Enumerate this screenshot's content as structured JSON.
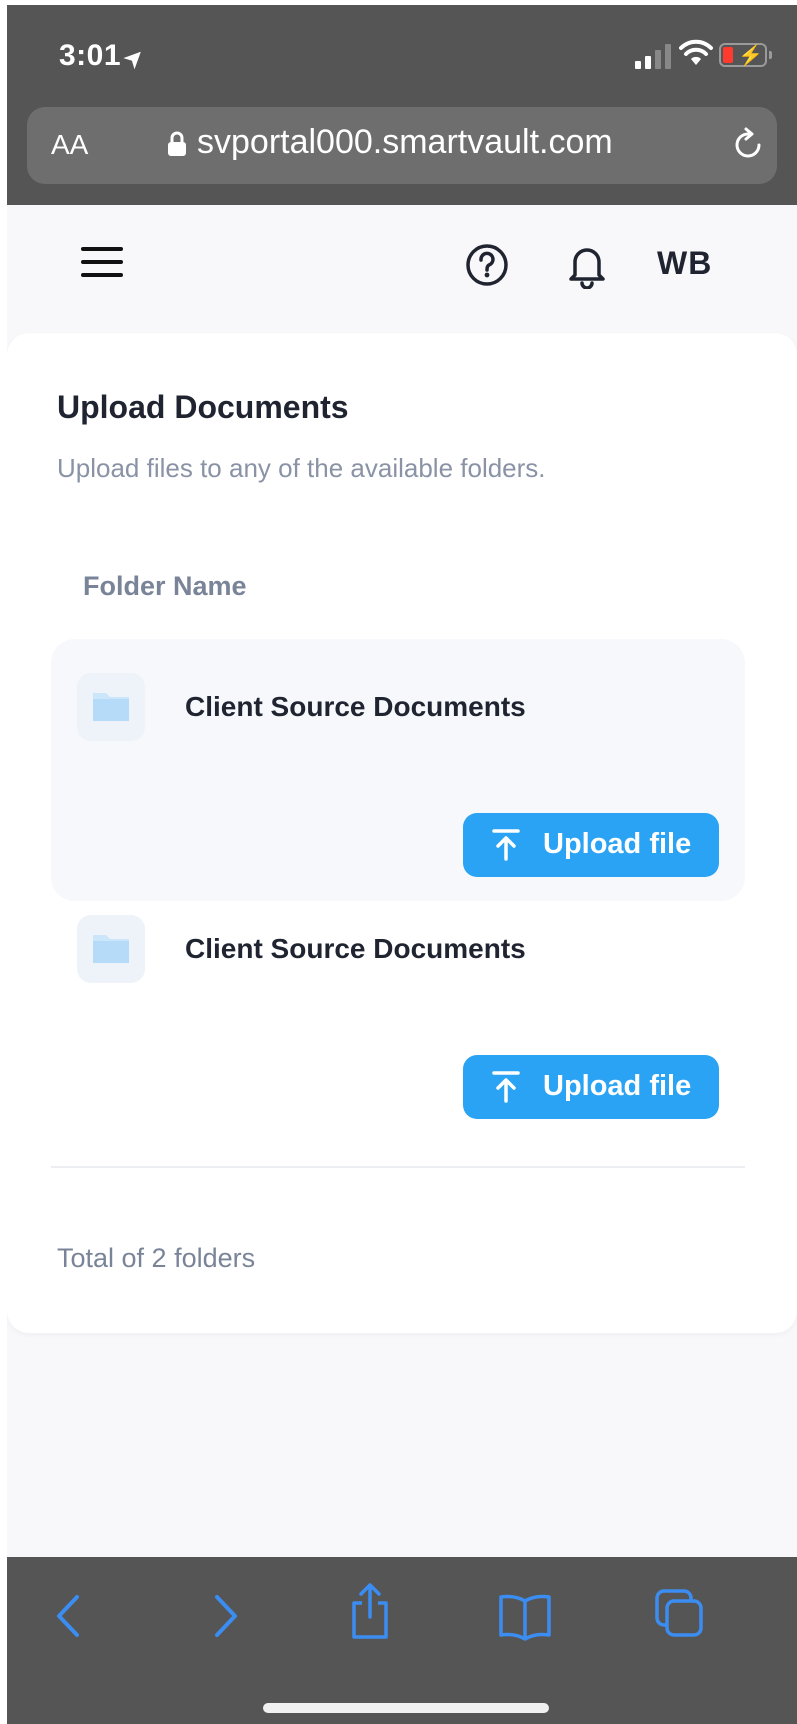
{
  "status_bar": {
    "time": "3:01"
  },
  "browser": {
    "text_size_label": "AA",
    "url": "svportal000.smartvault.com"
  },
  "header": {
    "user_initials": "WB"
  },
  "page": {
    "title": "Upload Documents",
    "subtitle": "Upload files to any of the available folders.",
    "column_header": "Folder Name",
    "folders": [
      {
        "name": "Client Source Documents",
        "upload_label": "Upload file"
      },
      {
        "name": "Client Source Documents",
        "upload_label": "Upload file"
      }
    ],
    "footer": "Total of 2 folders"
  },
  "colors": {
    "accent": "#2aa3f5",
    "chrome": "#555555",
    "toolbar_icons": "#3b8df1"
  },
  "icons": [
    "location-arrow-icon",
    "signal-icon",
    "wifi-icon",
    "battery-icon",
    "lock-icon",
    "reload-icon",
    "hamburger-menu-icon",
    "help-icon",
    "bell-icon",
    "folder-icon",
    "upload-icon",
    "back-icon",
    "forward-icon",
    "share-icon",
    "bookmarks-icon",
    "tabs-icon"
  ]
}
